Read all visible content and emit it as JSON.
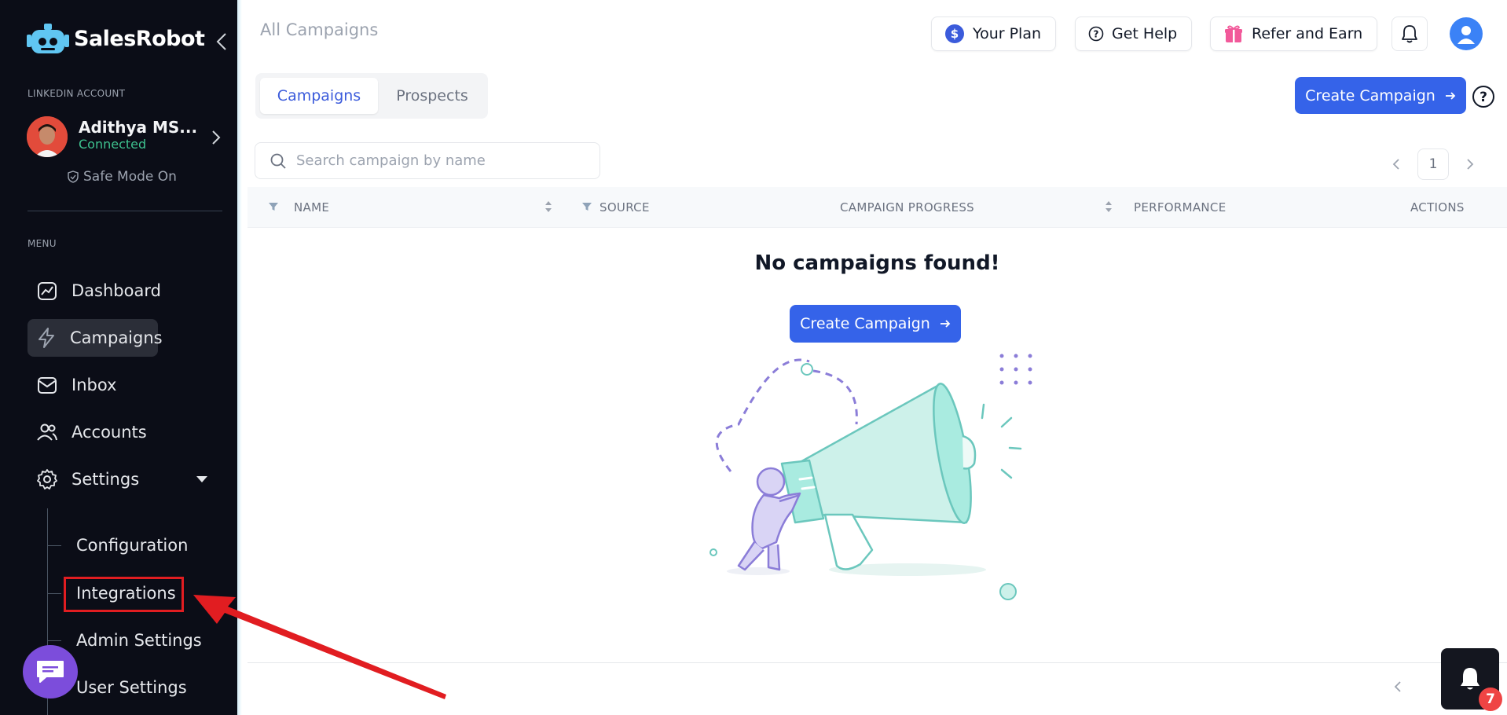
{
  "brand": {
    "name": "SalesRobot"
  },
  "sidebar": {
    "linkedin_label": "LINKEDIN ACCOUNT",
    "account": {
      "name": "Adithya MS...",
      "status": "Connected",
      "safe_mode": "Safe Mode On"
    },
    "menu_label": "MENU",
    "items": [
      {
        "label": "Dashboard",
        "icon": "dashboard-icon"
      },
      {
        "label": "Campaigns",
        "icon": "lightning-icon",
        "active": true
      },
      {
        "label": "Inbox",
        "icon": "inbox-icon"
      },
      {
        "label": "Accounts",
        "icon": "users-icon"
      },
      {
        "label": "Settings",
        "icon": "gear-icon",
        "expanded": true
      }
    ],
    "settings_sub": [
      {
        "label": "Configuration"
      },
      {
        "label": "Integrations",
        "highlighted": true
      },
      {
        "label": "Admin Settings"
      },
      {
        "label": "User Settings"
      }
    ]
  },
  "header": {
    "title": "All Campaigns",
    "your_plan": "Your Plan",
    "get_help": "Get Help",
    "refer": "Refer and Earn"
  },
  "tabs": [
    {
      "label": "Campaigns",
      "active": true
    },
    {
      "label": "Prospects",
      "active": false
    }
  ],
  "actions": {
    "create_campaign": "Create Campaign"
  },
  "search": {
    "placeholder": "Search campaign by name",
    "value": ""
  },
  "pagination": {
    "current": "1"
  },
  "table": {
    "columns": [
      "NAME",
      "SOURCE",
      "CAMPAIGN PROGRESS",
      "PERFORMANCE",
      "ACTIONS"
    ]
  },
  "empty": {
    "title": "No campaigns found!",
    "button": "Create Campaign"
  },
  "notifications": {
    "count": "7"
  },
  "colors": {
    "accent": "#3563e9",
    "sidebar_bg": "#0b0d17",
    "connected": "#3ec28f",
    "annotation_red": "#e11d21"
  }
}
